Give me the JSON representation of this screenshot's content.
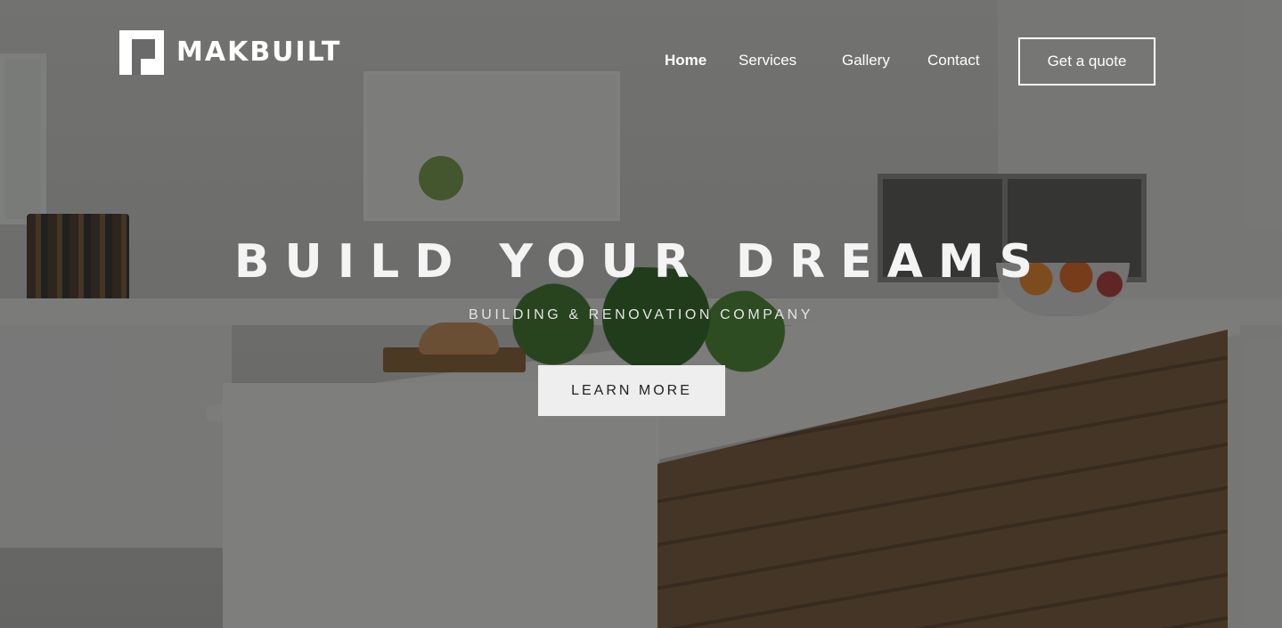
{
  "header": {
    "logo_text": "MAKBUILT",
    "nav": [
      {
        "label": "Home"
      },
      {
        "label": "Services"
      },
      {
        "label": "Gallery"
      },
      {
        "label": "Contact"
      }
    ],
    "cta_label": "Get a quote"
  },
  "hero": {
    "title": "BUILD YOUR DREAMS",
    "subtitle": "BUILDING & RENOVATION COMPANY",
    "button_label": "LEARN MORE",
    "background": "kitchen-photo"
  },
  "colors": {
    "text": "#ffffff",
    "overlay": "#141414",
    "button_bg": "#eeeeee",
    "button_text": "#222222"
  }
}
